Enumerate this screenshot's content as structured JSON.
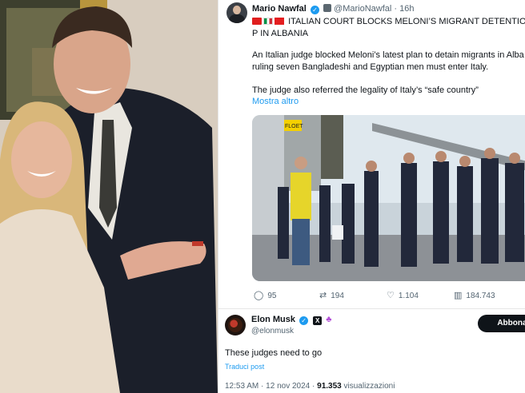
{
  "photo": {
    "alt_subject": "two people posing"
  },
  "quoted_tweet": {
    "author_name": "Mario Nawfal",
    "handle": "@MarioNawfal",
    "dot": "·",
    "time": "16h",
    "title": "ITALIAN COURT BLOCKS MELONI’S MIGRANT DETENTION P IN ALBANIA",
    "body_p1": "An Italian judge blocked Meloni’s latest plan to detain migrants in Alba ruling seven Bangladeshi and Egyptian men must enter Italy.",
    "body_p2": "The judge also referred the legality of Italy’s “safe country”",
    "show_more": "Mostra altro",
    "media_sign": "FLOET",
    "actions": {
      "replies": "95",
      "reposts": "194",
      "likes": "1.104",
      "views": "184.743"
    }
  },
  "main_tweet": {
    "author_name": "Elon Musk",
    "x_badge": "X",
    "extra_badge": "♣",
    "handle": "@elonmusk",
    "follow_label": "Abbonati",
    "text": "These judges need to go",
    "translate": "Traduci post",
    "time": "12:53 AM",
    "sep": "·",
    "date": "12 nov 2024",
    "views_count": "91.353",
    "views_label": "visualizzazioni"
  },
  "colors": {
    "accent": "#1d9bf0",
    "text": "#0f1419",
    "muted": "#536471"
  },
  "icons": {
    "reply": "reply-icon",
    "repost": "repost-icon",
    "like": "heart-icon",
    "views": "views-icon"
  }
}
